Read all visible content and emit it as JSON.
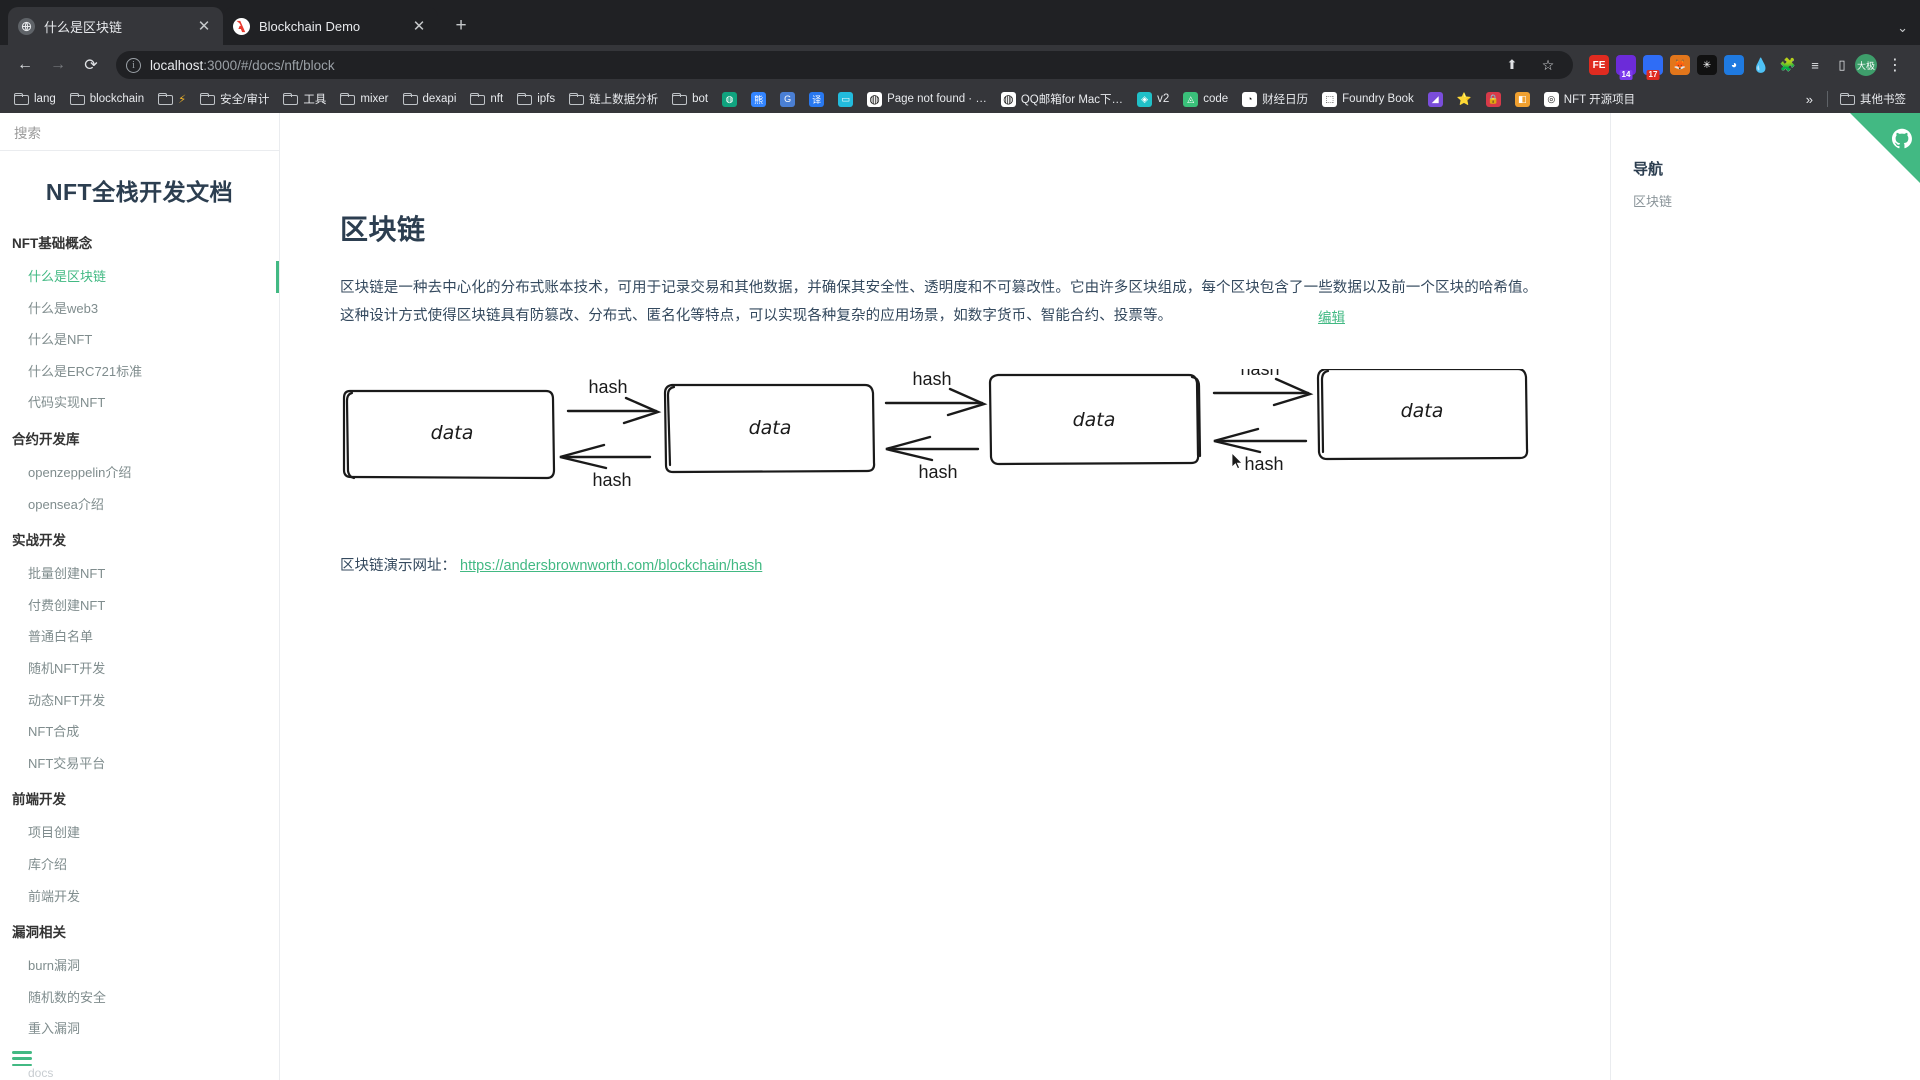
{
  "browser": {
    "tabs": [
      {
        "title": "什么是区块链",
        "favicon": "docs-icon",
        "active": true
      },
      {
        "title": "Blockchain Demo",
        "favicon": "adobe-icon",
        "active": false
      }
    ],
    "new_tab_label": "+",
    "window_controls_label": "⌄",
    "nav": {
      "back_label": "←",
      "forward_label": "→",
      "reload_label": "⟳"
    },
    "omnibox": {
      "info_label": "i",
      "url_host": "localhost",
      "url_path": ":3000/#/docs/nft/block",
      "share_label": "⬆",
      "bookmark_label": "☆"
    },
    "extensions": [
      {
        "name": "fe-extension",
        "label": "FE",
        "color": "#e02b20",
        "badge": "",
        "badge_color": ""
      },
      {
        "name": "purple-wallet-extension",
        "label": "",
        "color": "#6c2bd9",
        "badge": "14",
        "badge_color": "#7c3aed"
      },
      {
        "name": "blue-wallet-extension",
        "label": "",
        "color": "#2f6df6",
        "badge": "17",
        "badge_color": "#e02b20"
      },
      {
        "name": "metamask-extension",
        "label": "",
        "color": "#e2761b",
        "badge": "",
        "badge_color": ""
      },
      {
        "name": "snowflake-extension",
        "label": "✳",
        "color": "#111111",
        "badge": "",
        "badge_color": ""
      },
      {
        "name": "rainbow-extension",
        "label": "",
        "color": "#1f7ae0",
        "badge": "",
        "badge_color": ""
      },
      {
        "name": "water-drop-extension",
        "label": "💧",
        "color": "#35363a",
        "badge": "",
        "badge_color": ""
      },
      {
        "name": "puzzle-extensions-icon",
        "label": "🧩",
        "color": "#35363a",
        "badge": "",
        "badge_color": ""
      },
      {
        "name": "reading-list-icon",
        "label": "≡",
        "color": "#35363a",
        "badge": "",
        "badge_color": ""
      },
      {
        "name": "side-panel-icon",
        "label": "▯",
        "color": "#35363a",
        "badge": "",
        "badge_color": ""
      }
    ],
    "profile_label": "大极",
    "menu_label": "⋮",
    "bookmarks": [
      {
        "name": "lang",
        "label": "lang",
        "type": "folder"
      },
      {
        "name": "blockchain",
        "label": "blockchain",
        "type": "folder"
      },
      {
        "name": "lightning",
        "label": "",
        "type": "folder-icon",
        "glyph": "⚡",
        "color": "#35363a"
      },
      {
        "name": "security-audit",
        "label": "安全/审计",
        "type": "folder"
      },
      {
        "name": "tools",
        "label": "工具",
        "type": "folder"
      },
      {
        "name": "mixer",
        "label": "mixer",
        "type": "folder"
      },
      {
        "name": "dexapi",
        "label": "dexapi",
        "type": "folder"
      },
      {
        "name": "nft",
        "label": "nft",
        "type": "folder"
      },
      {
        "name": "ipfs",
        "label": "ipfs",
        "type": "folder"
      },
      {
        "name": "onchain-analytics",
        "label": "链上数据分析",
        "type": "folder"
      },
      {
        "name": "bot",
        "label": "bot",
        "type": "folder"
      },
      {
        "name": "openai",
        "label": "",
        "type": "site",
        "glyph": "◍",
        "color": "#10a37f"
      },
      {
        "name": "baidu",
        "label": "",
        "type": "site",
        "glyph": "熊",
        "color": "#3385ff"
      },
      {
        "name": "gitee",
        "label": "",
        "type": "site",
        "glyph": "G",
        "color": "#4a7fd4"
      },
      {
        "name": "translate",
        "label": "",
        "type": "site",
        "glyph": "译",
        "color": "#2878f0"
      },
      {
        "name": "bilibili",
        "label": "",
        "type": "site",
        "glyph": "▭",
        "color": "#22bbdd"
      },
      {
        "name": "page-not-found",
        "label": "Page not found · …",
        "type": "site",
        "glyph": "",
        "color": "#ffffff"
      },
      {
        "name": "qq-mail-mac",
        "label": "QQ邮箱for Mac下…",
        "type": "site",
        "glyph": "◍",
        "color": "#ffffff"
      },
      {
        "name": "v2",
        "label": "v2",
        "type": "site",
        "glyph": "◈",
        "color": "#20c0c8"
      },
      {
        "name": "code",
        "label": "code",
        "type": "site",
        "glyph": "◬",
        "color": "#3ac07a"
      },
      {
        "name": "finance-calendar",
        "label": "财经日历",
        "type": "site",
        "glyph": "◔",
        "color": "#ffffff"
      },
      {
        "name": "foundry-book",
        "label": "Foundry Book",
        "type": "site",
        "glyph": "⬚",
        "color": "#ffffff"
      },
      {
        "name": "rainbow-site",
        "label": "",
        "type": "site",
        "glyph": "◢",
        "color": "#7a4ddb"
      },
      {
        "name": "star-site",
        "label": "",
        "type": "site",
        "glyph": "⭐",
        "color": "#35363a"
      },
      {
        "name": "lock-site",
        "label": "",
        "type": "site",
        "glyph": "🔒",
        "color": "#d73a49"
      },
      {
        "name": "yellow-site",
        "label": "",
        "type": "site",
        "glyph": "◧",
        "color": "#f0a030"
      },
      {
        "name": "nft-open-source",
        "label": "NFT 开源项目",
        "type": "site",
        "glyph": "◎",
        "color": "#ffffff"
      }
    ],
    "bookmarks_overflow_label": "»",
    "other_bookmarks_label": "其他书签"
  },
  "sidebar": {
    "search_placeholder": "搜索",
    "doc_title": "NFT全栈开发文档",
    "sections": [
      {
        "title": "NFT基础概念",
        "items": [
          {
            "label": "什么是区块链",
            "active": true
          },
          {
            "label": "什么是web3",
            "active": false
          },
          {
            "label": "什么是NFT",
            "active": false
          },
          {
            "label": "什么是ERC721标准",
            "active": false
          },
          {
            "label": "代码实现NFT",
            "active": false
          }
        ]
      },
      {
        "title": "合约开发库",
        "items": [
          {
            "label": "openzeppelin介绍",
            "active": false
          },
          {
            "label": "opensea介绍",
            "active": false
          }
        ]
      },
      {
        "title": "实战开发",
        "items": [
          {
            "label": "批量创建NFT",
            "active": false
          },
          {
            "label": "付费创建NFT",
            "active": false
          },
          {
            "label": "普通白名单",
            "active": false
          },
          {
            "label": "随机NFT开发",
            "active": false
          },
          {
            "label": "动态NFT开发",
            "active": false
          },
          {
            "label": "NFT合成",
            "active": false
          },
          {
            "label": "NFT交易平台",
            "active": false
          }
        ]
      },
      {
        "title": "前端开发",
        "items": [
          {
            "label": "项目创建",
            "active": false
          },
          {
            "label": "库介绍",
            "active": false
          },
          {
            "label": "前端开发",
            "active": false
          }
        ]
      },
      {
        "title": "漏洞相关",
        "items": [
          {
            "label": "burn漏洞",
            "active": false
          },
          {
            "label": "随机数的安全",
            "active": false
          },
          {
            "label": "重入漏洞",
            "active": false
          }
        ]
      }
    ],
    "footer_label": "docs"
  },
  "content": {
    "edit_label": "编辑",
    "title": "区块链",
    "paragraph": "区块链是一种去中心化的分布式账本技术，可用于记录交易和其他数据，并确保其安全性、透明度和不可篡改性。它由许多区块组成，每个区块包含了一些数据以及前一个区块的哈希值。这种设计方式使得区块链具有防篡改、分布式、匿名化等特点，可以实现各种复杂的应用场景，如数字货币、智能合约、投票等。",
    "demo_label": "区块链演示网址：",
    "demo_url": "https://andersbrownworth.com/blockchain/hash",
    "diagram": {
      "type": "blockchain-chain",
      "blocks": [
        {
          "label": "data"
        },
        {
          "label": "data"
        },
        {
          "label": "data"
        },
        {
          "label": "data"
        }
      ],
      "arrow_label": "hash",
      "connectors": [
        {
          "forward_label": "hash",
          "back_label": "hash"
        },
        {
          "forward_label": "hash",
          "back_label": "hash"
        },
        {
          "forward_label": "hash",
          "back_label": "hash"
        }
      ]
    }
  },
  "toc": {
    "title": "导航",
    "items": [
      {
        "label": "区块链"
      }
    ]
  },
  "github_corner": {
    "name": "github-corner",
    "color": "#42b983"
  },
  "colors": {
    "accent": "#42b983",
    "heading": "#2c3e50",
    "body_text": "#34495e",
    "muted": "#7f8c8d",
    "chrome_bg": "#35363a",
    "tabstrip_bg": "#202124"
  }
}
